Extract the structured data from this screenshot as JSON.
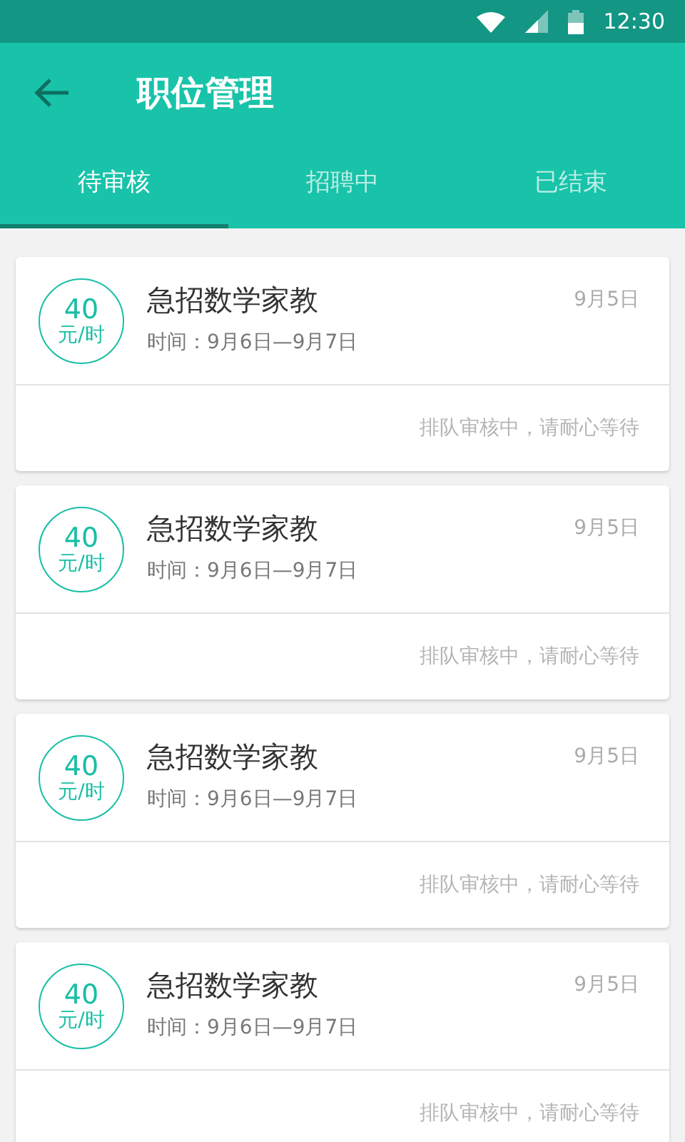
{
  "status_bar": {
    "time": "12:30"
  },
  "app_bar": {
    "title": "职位管理"
  },
  "tabs": [
    {
      "label": "待审核",
      "selected": true
    },
    {
      "label": "招聘中",
      "selected": false
    },
    {
      "label": "已结束",
      "selected": false
    }
  ],
  "jobs": [
    {
      "price": "40",
      "unit": "元/时",
      "title": "急招数学家教",
      "date": "9月5日",
      "time": "时间：9月6日—9月7日",
      "status": "排队审核中，请耐心等待"
    },
    {
      "price": "40",
      "unit": "元/时",
      "title": "急招数学家教",
      "date": "9月5日",
      "time": "时间：9月6日—9月7日",
      "status": "排队审核中，请耐心等待"
    },
    {
      "price": "40",
      "unit": "元/时",
      "title": "急招数学家教",
      "date": "9月5日",
      "time": "时间：9月6日—9月7日",
      "status": "排队审核中，请耐心等待"
    },
    {
      "price": "40",
      "unit": "元/时",
      "title": "急招数学家教",
      "date": "9月5日",
      "time": "时间：9月6日—9月7日",
      "status": "排队审核中，请耐心等待"
    }
  ]
}
